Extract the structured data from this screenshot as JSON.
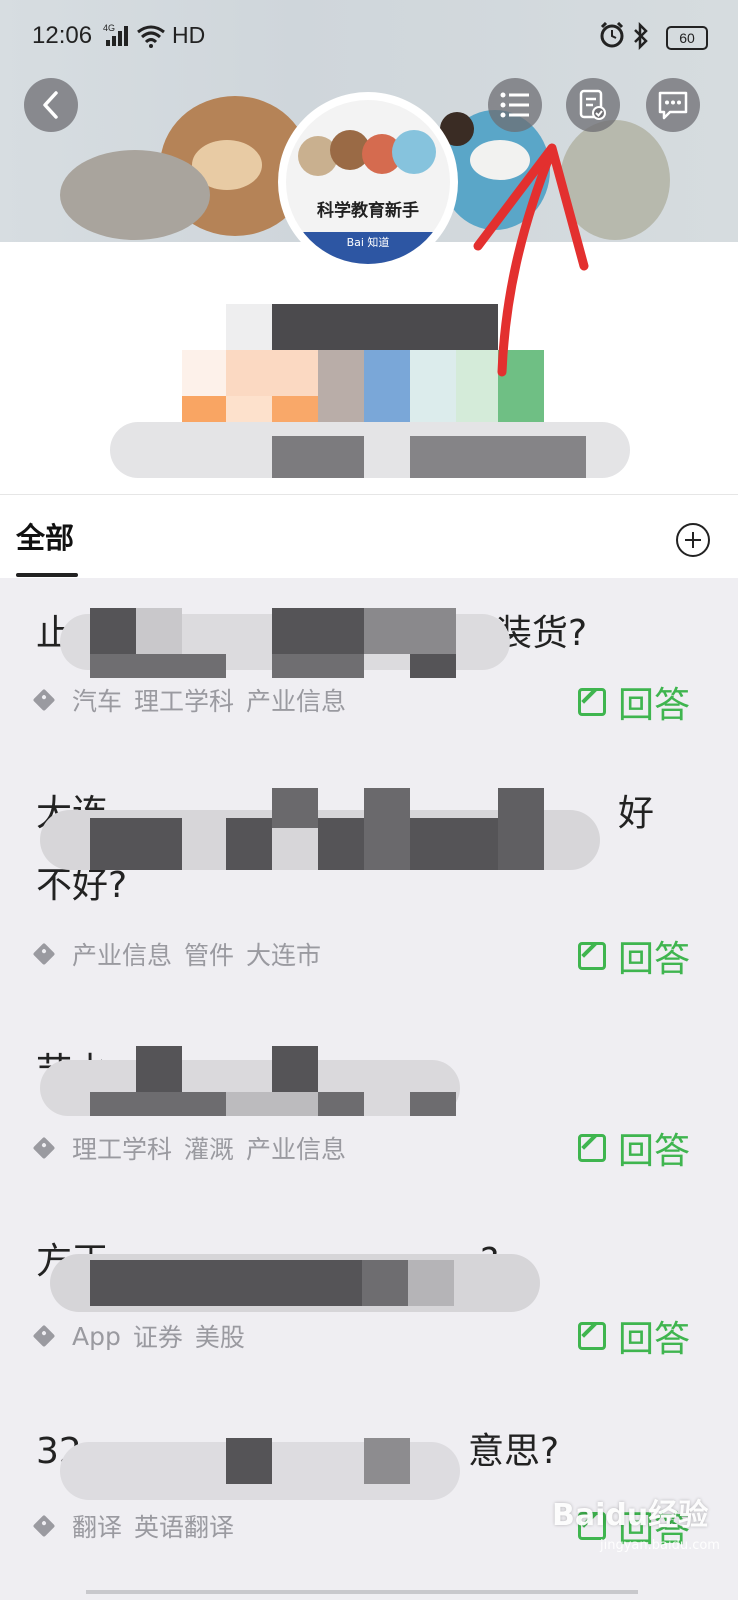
{
  "status_bar": {
    "time": "12:06",
    "network": "4G",
    "hd": "HD",
    "battery": "60"
  },
  "header": {
    "back_icon": "chevron-left-icon",
    "list_icon": "list-icon",
    "doc_check_icon": "document-check-icon",
    "message_icon": "chat-bubble-icon"
  },
  "avatar": {
    "text": "科学教育新手",
    "brand": "Bai 知道"
  },
  "tabs": {
    "all": "全部"
  },
  "questions": [
    {
      "title": "止水",
      "title_tail": "车装货?",
      "tags": [
        "汽车",
        "理工学科",
        "产业信息"
      ],
      "answer": "回答"
    },
    {
      "title": "大连",
      "title_tail": "好",
      "title_line2": "不好?",
      "tags": [
        "产业信息",
        "管件",
        "大连市"
      ],
      "answer": "回答"
    },
    {
      "title": "节水",
      "tags": [
        "理工学科",
        "灌溉",
        "产业信息"
      ],
      "answer": "回答"
    },
    {
      "title": "方正",
      "title_tail": "?",
      "tags": [
        "App",
        "证券",
        "美股"
      ],
      "answer": "回答"
    },
    {
      "title": "32",
      "title_tail": "意思?",
      "tags": [
        "翻译",
        "英语翻译"
      ],
      "answer": "回答"
    }
  ],
  "watermark": {
    "text": "Baidu经验",
    "sub": "jingyan.baidu.com"
  },
  "colors": {
    "accent_green": "#3fb54f",
    "annotation_red": "#e3302f"
  }
}
